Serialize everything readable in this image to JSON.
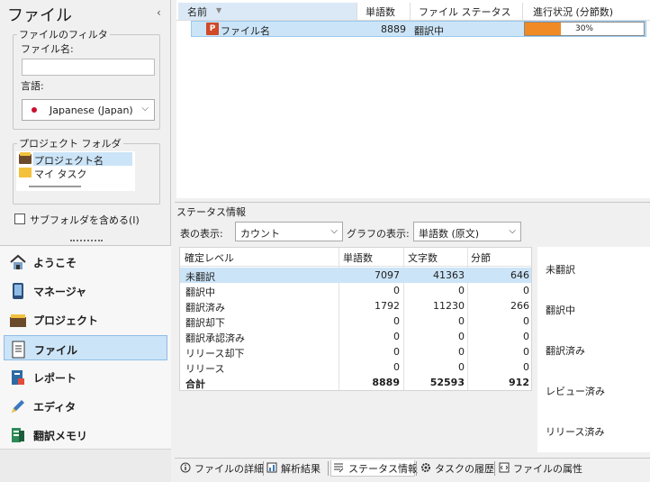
{
  "left_panel": {
    "title": "ファイル",
    "collapse_icon": "chevron-left-icon",
    "filter": {
      "legend": "ファイルのフィルタ",
      "file_name_label": "ファイル名:",
      "file_name_value": "",
      "language_label": "言語:",
      "language_value": "Japanese (Japan)"
    },
    "folders": {
      "legend": "プロジェクト フォルダ",
      "items": [
        "プロジェクト名",
        "マイ タスク"
      ]
    },
    "subfolder_label": "サブフォルダを含める(I)",
    "subfolder_checked": false
  },
  "nav": {
    "items": [
      {
        "label": "ようこそ",
        "icon": "home-icon"
      },
      {
        "label": "マネージャ",
        "icon": "phone-icon"
      },
      {
        "label": "プロジェクト",
        "icon": "projects-icon"
      },
      {
        "label": "ファイル",
        "icon": "files-icon"
      },
      {
        "label": "レポート",
        "icon": "report-icon"
      },
      {
        "label": "エディタ",
        "icon": "pencil-icon"
      },
      {
        "label": "翻訳メモリ",
        "icon": "tm-icon"
      }
    ],
    "selected": "ファイル"
  },
  "file_grid": {
    "columns": [
      "名前",
      "単語数",
      "ファイル ステータス",
      "進行状況 (分節数)"
    ],
    "rows": [
      {
        "name": "ファイル名",
        "words": "8889",
        "status": "翻訳中",
        "progress_label": "30%",
        "progress": 30
      }
    ]
  },
  "status_info": {
    "title": "ステータス情報",
    "table_label": "表の表示:",
    "table_value": "カウント",
    "graph_label": "グラフの表示:",
    "graph_value": "単語数 (原文)",
    "headers": [
      "確定レベル",
      "単語数",
      "文字数",
      "分節"
    ],
    "rows": [
      {
        "level": "未翻訳",
        "words": "7097",
        "chars": "41363",
        "segments": "646"
      },
      {
        "level": "翻訳中",
        "words": "0",
        "chars": "0",
        "segments": "0"
      },
      {
        "level": "翻訳済み",
        "words": "1792",
        "chars": "11230",
        "segments": "266"
      },
      {
        "level": "翻訳却下",
        "words": "0",
        "chars": "0",
        "segments": "0"
      },
      {
        "level": "翻訳承認済み",
        "words": "0",
        "chars": "0",
        "segments": "0"
      },
      {
        "level": "リリース却下",
        "words": "0",
        "chars": "0",
        "segments": "0"
      },
      {
        "level": "リリース",
        "words": "0",
        "chars": "0",
        "segments": "0"
      },
      {
        "level": "合計",
        "words": "8889",
        "chars": "52593",
        "segments": "912"
      }
    ],
    "chart_labels": [
      "未翻訳",
      "翻訳中",
      "翻訳済み",
      "レビュー済み",
      "リリース済み"
    ]
  },
  "bottom_tabs": [
    {
      "label": "ファイルの詳細",
      "icon": "info-icon"
    },
    {
      "label": "解析結果",
      "icon": "analysis-icon"
    },
    {
      "label": "ステータス情報",
      "icon": "status-icon"
    },
    {
      "label": "タスクの履歴",
      "icon": "gear-icon"
    },
    {
      "label": "ファイルの属性",
      "icon": "attributes-icon"
    }
  ],
  "active_tab": "ステータス情報",
  "colors": {
    "selection": "#cce4f7",
    "progress": "#f08a24",
    "file_icon": "#d04a27"
  }
}
